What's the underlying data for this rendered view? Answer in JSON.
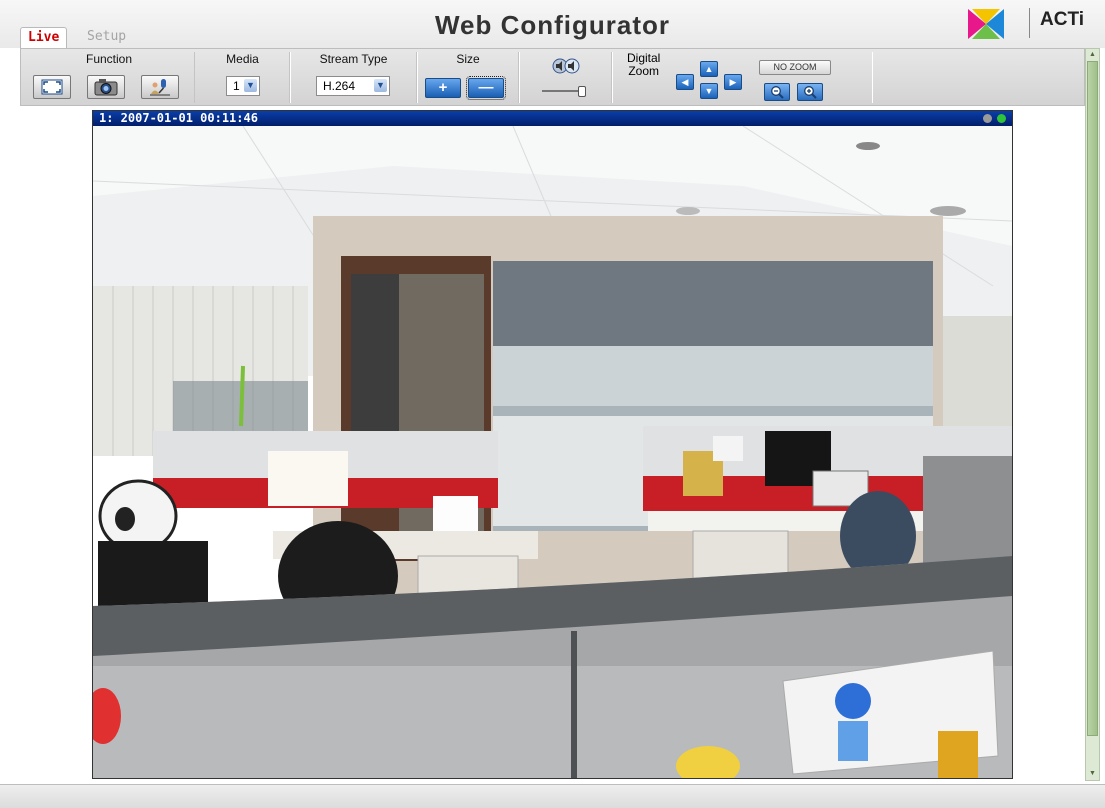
{
  "tabs": {
    "live": "Live",
    "setup": "Setup"
  },
  "app_title": "Web Configurator",
  "brand": {
    "name": "ACTi",
    "logo_icon": "acti-bowtie-logo-icon"
  },
  "toolbar": {
    "function": {
      "label": "Function",
      "buttons": [
        "fullscreen-icon",
        "snapshot-camera-icon",
        "microphone-talk-icon"
      ]
    },
    "media": {
      "label": "Media",
      "value": "1"
    },
    "stream_type": {
      "label": "Stream Type",
      "value": "H.264"
    },
    "size": {
      "label": "Size",
      "increase": "+",
      "decrease": "—"
    },
    "audio": {
      "icon": "speaker-volume-icon",
      "volume_level": 0.9
    },
    "digital_zoom": {
      "label_line1": "Digital",
      "label_line2": "Zoom",
      "no_zoom": "NO ZOOM",
      "arrows": {
        "up": "▲",
        "down": "▼",
        "left": "◀",
        "right": "▶"
      }
    }
  },
  "video": {
    "channel_timestamp": "1:  2007-01-01 00:11:46",
    "status_dots": [
      "#9a9a9a",
      "#2fc33a"
    ]
  }
}
